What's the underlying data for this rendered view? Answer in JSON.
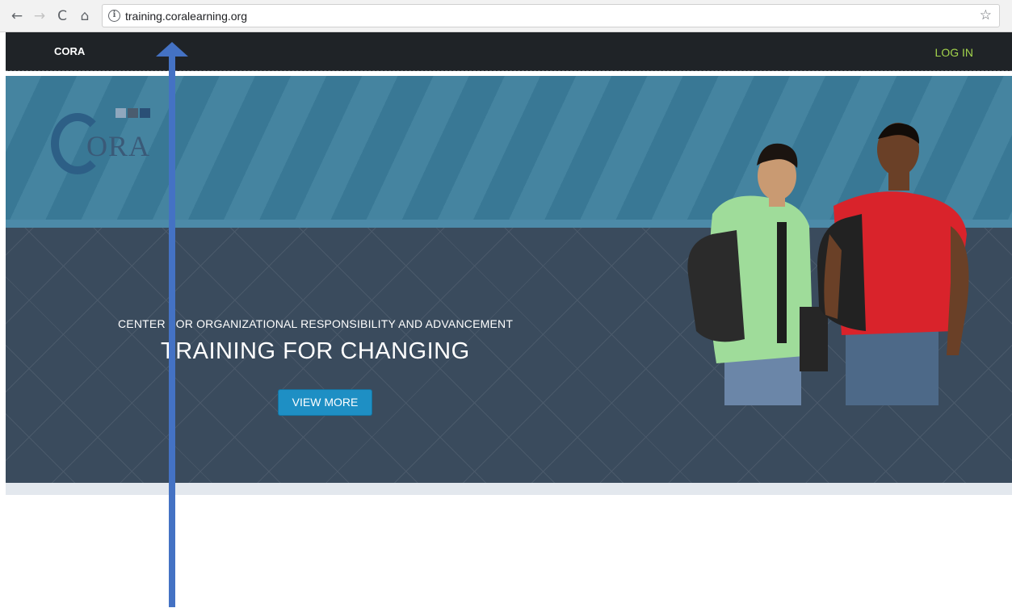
{
  "browser": {
    "url": "training.coralearning.org",
    "back_icon": "←",
    "forward_icon": "→",
    "reload_icon": "C",
    "home_icon": "⌂",
    "info_icon": "i",
    "star_icon": "☆"
  },
  "site": {
    "brand": "CORA",
    "login": "LOG IN",
    "logo_text": "ORA",
    "subtitle": "CENTER FOR ORGANIZATIONAL RESPONSIBILITY AND ADVANCEMENT",
    "headline": "TRAINING FOR CHANGING",
    "cta": "VIEW MORE"
  },
  "colors": {
    "topbar": "#1f2327",
    "login": "#a3d44c",
    "banner": "#3b7d9b",
    "hero": "#3a4b5d",
    "cta": "#1e8fc4",
    "arrow": "#4472c4"
  }
}
